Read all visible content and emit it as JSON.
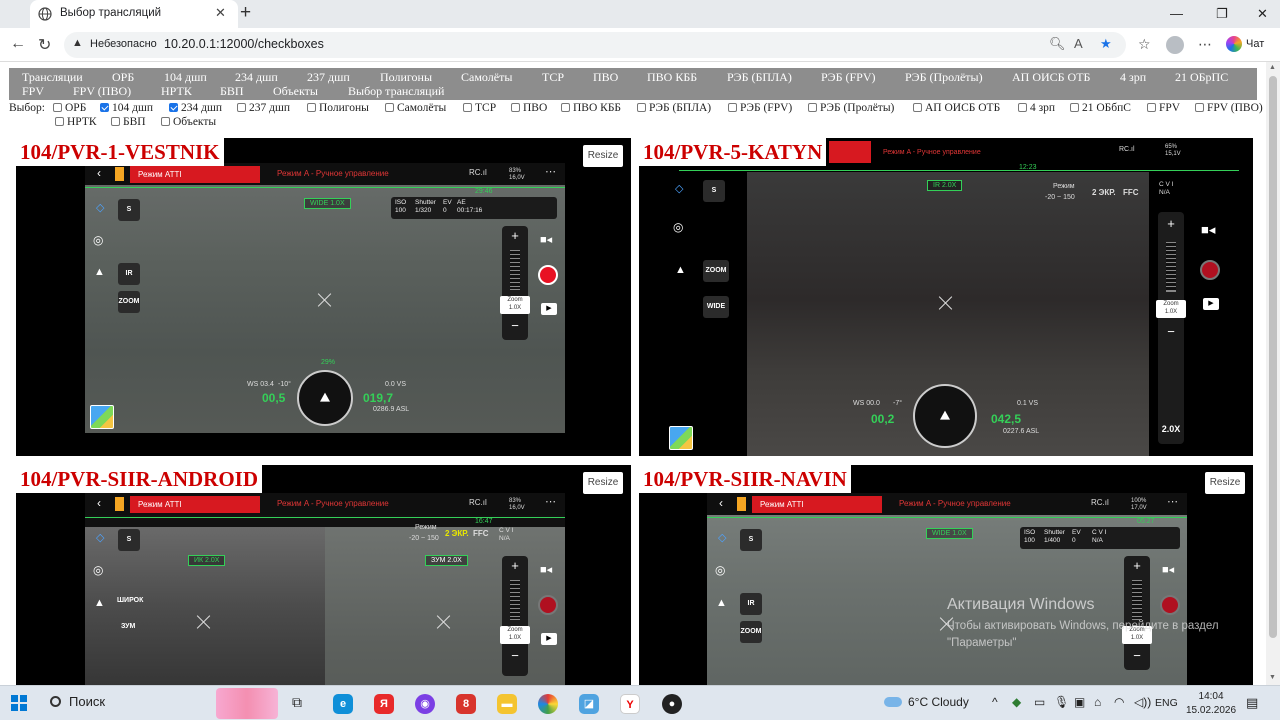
{
  "browser": {
    "tab_title": "Выбор трансляций",
    "insecure_label": "Небезопасно",
    "url": "10.20.0.1:12000/checkboxes",
    "chat_label": "Чат"
  },
  "menu": {
    "items": [
      "Трансляции",
      "ОРБ",
      "104 дшп",
      "234 дшп",
      "237 дшп",
      "Полигоны",
      "Самолёты",
      "ТСР",
      "ПВО",
      "ПВО КББ",
      "РЭБ (БПЛА)",
      "РЭБ (FPV)",
      "РЭБ (Пролёты)",
      "АП ОИСБ ОТБ",
      "4 зрп",
      "21 ОБрПС",
      "FPV",
      "FPV (ПВО)",
      "НРТК",
      "БВП",
      "Объекты",
      "Выбор трансляций"
    ]
  },
  "selector": {
    "label": "Выбор:",
    "options": [
      {
        "label": "ОРБ",
        "checked": false
      },
      {
        "label": "104 дшп",
        "checked": true
      },
      {
        "label": "234 дшп",
        "checked": true
      },
      {
        "label": "237 дшп",
        "checked": false
      },
      {
        "label": "Полигоны",
        "checked": false
      },
      {
        "label": "Самолёты",
        "checked": false
      },
      {
        "label": "ТСР",
        "checked": false
      },
      {
        "label": "ПВО",
        "checked": false
      },
      {
        "label": "ПВО КББ",
        "checked": false
      },
      {
        "label": "РЭБ (БПЛА)",
        "checked": false
      },
      {
        "label": "РЭБ (FPV)",
        "checked": false
      },
      {
        "label": "РЭБ (Пролёты)",
        "checked": false
      },
      {
        "label": "АП ОИСБ ОТБ",
        "checked": false
      },
      {
        "label": "4 зрп",
        "checked": false
      },
      {
        "label": "21 ОБбпС",
        "checked": false
      },
      {
        "label": "FPV",
        "checked": false
      },
      {
        "label": "FPV (ПВО)",
        "checked": false
      },
      {
        "label": "НРТК",
        "checked": false
      },
      {
        "label": "БВП",
        "checked": false
      },
      {
        "label": "Объекты",
        "checked": false
      }
    ]
  },
  "resize_label": "Resize",
  "panels": [
    {
      "title": "104/PVR-1-VESTNIK",
      "mode_atti": "Режим ATTI",
      "mode_manual": "Режим A - Ручное управление",
      "rc": "RC.ıl",
      "battery": "83%\n16,0V",
      "time": "29:46",
      "zoom_box": "WIDE 1.0X",
      "iso": {
        "iso": "ISO\n100",
        "shutter": "Shutter\n1/320",
        "ev": "EV\n0",
        "ae": "AE\n00:17:16"
      },
      "btn_ir": "IR",
      "btn_zoom": "ZOOM",
      "zoom_value": "Zoom\n1.0X",
      "heading": "29%",
      "ws": "WS 03.4",
      "tilt": "-10°",
      "h_val": "00,5",
      "d_val": "019,7",
      "vs": "0.0 VS",
      "asl": "0286.9 ASL"
    },
    {
      "title": "104/PVR-5-KATYN",
      "mode_manual": "Режим A - Ручное управление",
      "rc": "RC.ıl",
      "battery": "65%\n15,1V",
      "time": "12:23",
      "ir_box": "IR 2.0X",
      "regime_label": "Режим",
      "regime_range": "-20 ~ 150",
      "ekr": "2 ЭКР.",
      "ffc": "FFC",
      "cvi": "C V I\nN/A",
      "btn_zoom": "ZOOM",
      "btn_wide": "WIDE",
      "zoom_value": "Zoom\n1.0X",
      "zoom_2x": "2.0X",
      "ws": "WS 00.0",
      "tilt": "-7°",
      "h_val": "00,2",
      "d_val": "042,5",
      "vs": "0.1 VS",
      "asl": "0227.6 ASL"
    },
    {
      "title": "104/PVR-SIIR-ANDROID",
      "mode_atti": "Режим ATTI",
      "mode_manual": "Режим A - Ручное управление",
      "rc": "RC.ıl",
      "battery": "83%\n16,0V",
      "time": "16:47",
      "ir_box": "ИК 2.0X",
      "zoom_box": "ЗУМ 2.0X",
      "regime_label": "Режим",
      "regime_range": "-20 ~ 150",
      "ekr": "2 ЭКР.",
      "ffc": "FFC",
      "cvi": "C V I\nN/A",
      "btn_wide": "ШИРОК",
      "btn_zoom": "ЗУМ",
      "zoom_value": "Zoom\n1.0X"
    },
    {
      "title": "104/PVR-SIIR-NAVIN",
      "mode_atti": "Режим ATTI",
      "mode_manual": "Режим A - Ручное управление",
      "rc": "RC.ıl",
      "battery": "100%\n17,0V",
      "time": "05:27",
      "zoom_box": "WIDE 1.0X",
      "iso": {
        "iso": "ISO\n100",
        "shutter": "Shutter\n1/400",
        "ev": "EV\n0",
        "ae": "C V I\nN/A"
      },
      "btn_ir": "IR",
      "btn_zoom": "ZOOM",
      "zoom_value": "Zoom\n1.0X"
    }
  ],
  "watermark": {
    "title": "Активация Windows",
    "line1": "Чтобы активировать Windows, перейдите в раздел",
    "line2": "\"Параметры\""
  },
  "taskbar": {
    "search_label": "Поиск",
    "weather": "6°C  Cloudy",
    "lang": "ENG",
    "time": "14:04",
    "date": "15.02.2026"
  }
}
